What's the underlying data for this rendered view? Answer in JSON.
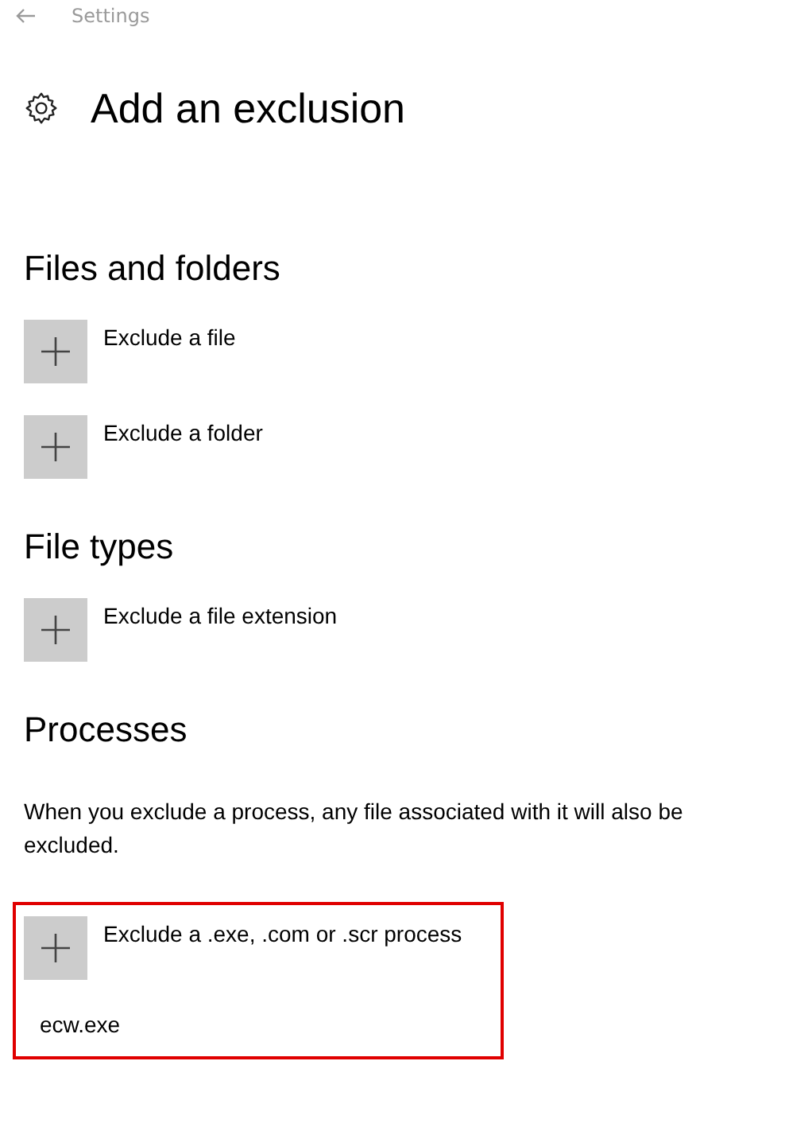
{
  "window": {
    "title": "Settings"
  },
  "page_title": "Add an exclusion",
  "sections": [
    {
      "heading": "Files and folders",
      "highlighted": false,
      "items": [
        {
          "kind": "add",
          "label": "Exclude a file"
        },
        {
          "kind": "add",
          "label": "Exclude a folder"
        }
      ]
    },
    {
      "heading": "File types",
      "highlighted": false,
      "items": [
        {
          "kind": "add",
          "label": "Exclude a file extension"
        }
      ]
    },
    {
      "heading": "Processes",
      "description": "When you exclude a process, any file associated with it will also be excluded.",
      "highlighted": true,
      "items": [
        {
          "kind": "add",
          "label": "Exclude a .exe, .com or .scr process"
        },
        {
          "kind": "entry",
          "label": "ecw.exe"
        }
      ]
    }
  ]
}
